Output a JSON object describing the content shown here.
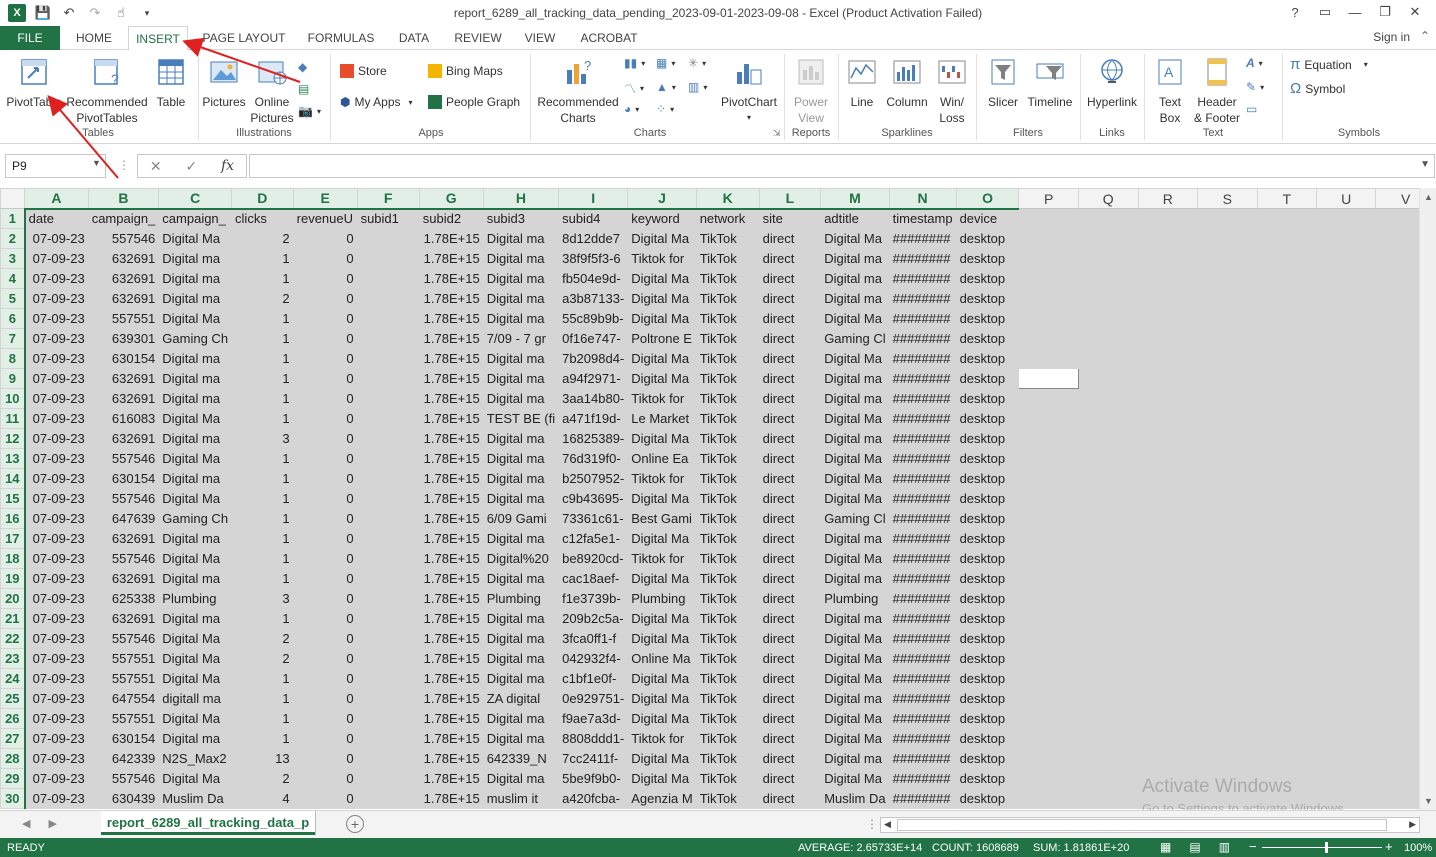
{
  "window": {
    "title": "report_6289_all_tracking_data_pending_2023-09-01-2023-09-08 - Excel (Product Activation Failed)",
    "controls": [
      "?",
      "▭",
      "—",
      "❐",
      "✕"
    ]
  },
  "tabs": [
    "FILE",
    "HOME",
    "INSERT",
    "PAGE LAYOUT",
    "FORMULAS",
    "DATA",
    "REVIEW",
    "VIEW",
    "ACROBAT"
  ],
  "signin": "Sign in",
  "ribbon": {
    "tables": {
      "pivottable": "PivotTable",
      "recommended_line1": "Recommended",
      "recommended_line2": "PivotTables",
      "table": "Table",
      "group": "Tables"
    },
    "illustrations": {
      "pictures": "Pictures",
      "online_line1": "Online",
      "online_line2": "Pictures",
      "group": "Illustrations"
    },
    "apps": {
      "store": "Store",
      "my_apps": "My Apps",
      "bing_maps": "Bing Maps",
      "people_graph": "People Graph",
      "group": "Apps"
    },
    "charts": {
      "recommended_line1": "Recommended",
      "recommended_line2": "Charts",
      "pivotchart": "PivotChart",
      "group": "Charts"
    },
    "reports": {
      "power_line1": "Power",
      "power_line2": "View",
      "group": "Reports"
    },
    "sparklines": {
      "line": "Line",
      "column": "Column",
      "winloss_line1": "Win/",
      "winloss_line2": "Loss",
      "group": "Sparklines"
    },
    "filters": {
      "slicer": "Slicer",
      "timeline": "Timeline",
      "group": "Filters"
    },
    "links": {
      "hyperlink": "Hyperlink",
      "group": "Links"
    },
    "text": {
      "textbox_line1": "Text",
      "textbox_line2": "Box",
      "header_line1": "Header",
      "header_line2": "& Footer",
      "group": "Text"
    },
    "symbols": {
      "equation": "Equation",
      "symbol": "Symbol",
      "group": "Symbols"
    }
  },
  "formula_bar": {
    "name_box": "P9",
    "fx": "fx",
    "value": ""
  },
  "columns": [
    "A",
    "B",
    "C",
    "D",
    "E",
    "F",
    "G",
    "H",
    "I",
    "J",
    "K",
    "L",
    "M",
    "N",
    "O",
    "P",
    "Q",
    "R",
    "S",
    "T",
    "U",
    "V"
  ],
  "header_row": [
    "date",
    "campaign_",
    "campaign_",
    "clicks",
    "revenueU",
    "subid1",
    "subid2",
    "subid3",
    "subid4",
    "keyword",
    "network",
    "site",
    "adtitle",
    "timestamp",
    "device"
  ],
  "rows": [
    [
      "07-09-23",
      "557546",
      "Digital Ma",
      "2",
      "0",
      "",
      "1.78E+15",
      "Digital ma",
      "8d12dde7",
      "Digital Ma",
      "TikTok",
      "direct",
      "Digital Ma",
      "########",
      "desktop"
    ],
    [
      "07-09-23",
      "632691",
      "Digital ma",
      "1",
      "0",
      "",
      "1.78E+15",
      "Digital ma",
      "38f9f5f3-6",
      "Tiktok for",
      "TikTok",
      "direct",
      "Digital ma",
      "########",
      "desktop"
    ],
    [
      "07-09-23",
      "632691",
      "Digital ma",
      "1",
      "0",
      "",
      "1.78E+15",
      "Digital ma",
      "fb504e9d-",
      "Digital Ma",
      "TikTok",
      "direct",
      "Digital ma",
      "########",
      "desktop"
    ],
    [
      "07-09-23",
      "632691",
      "Digital ma",
      "2",
      "0",
      "",
      "1.78E+15",
      "Digital ma",
      "a3b87133-",
      "Digital Ma",
      "TikTok",
      "direct",
      "Digital ma",
      "########",
      "desktop"
    ],
    [
      "07-09-23",
      "557551",
      "Digital Ma",
      "1",
      "0",
      "",
      "1.78E+15",
      "Digital ma",
      "55c89b9b-",
      "Digital Ma",
      "TikTok",
      "direct",
      "Digital Ma",
      "########",
      "desktop"
    ],
    [
      "07-09-23",
      "639301",
      "Gaming Ch",
      "1",
      "0",
      "",
      "1.78E+15",
      "7/09 - 7 gr",
      "0f16e747-",
      "Poltrone E",
      "TikTok",
      "direct",
      "Gaming Cl",
      "########",
      "desktop"
    ],
    [
      "07-09-23",
      "630154",
      "Digital ma",
      "1",
      "0",
      "",
      "1.78E+15",
      "Digital ma",
      "7b2098d4-",
      "Digital Ma",
      "TikTok",
      "direct",
      " Digital Ma",
      "########",
      "desktop"
    ],
    [
      "07-09-23",
      "632691",
      "Digital ma",
      "1",
      "0",
      "",
      "1.78E+15",
      "Digital ma",
      "a94f2971-",
      "Digital Ma",
      "TikTok",
      "direct",
      "Digital ma",
      "########",
      "desktop"
    ],
    [
      "07-09-23",
      "632691",
      "Digital ma",
      "1",
      "0",
      "",
      "1.78E+15",
      "Digital ma",
      "3aa14b80-",
      "Tiktok for",
      "TikTok",
      "direct",
      "Digital ma",
      "########",
      "desktop"
    ],
    [
      "07-09-23",
      "616083",
      "Digital Ma",
      "1",
      "0",
      "",
      "1.78E+15",
      "TEST BE (fi",
      "a471f19d-",
      "Le Market",
      "TikTok",
      "direct",
      "Digital Ma",
      "########",
      "desktop"
    ],
    [
      "07-09-23",
      "632691",
      "Digital ma",
      "3",
      "0",
      "",
      "1.78E+15",
      "Digital ma",
      "16825389-",
      "Digital Ma",
      "TikTok",
      "direct",
      "Digital ma",
      "########",
      "desktop"
    ],
    [
      "07-09-23",
      "557546",
      "Digital Ma",
      "1",
      "0",
      "",
      "1.78E+15",
      "Digital ma",
      "76d319f0-",
      "Online Ea",
      "TikTok",
      "direct",
      "Digital Ma",
      "########",
      "desktop"
    ],
    [
      "07-09-23",
      "630154",
      "Digital ma",
      "1",
      "0",
      "",
      "1.78E+15",
      "Digital ma",
      "b2507952-",
      "Tiktok for",
      "TikTok",
      "direct",
      " Digital Ma",
      "########",
      "desktop"
    ],
    [
      "07-09-23",
      "557546",
      "Digital Ma",
      "1",
      "0",
      "",
      "1.78E+15",
      "Digital ma",
      "c9b43695-",
      "Digital Ma",
      "TikTok",
      "direct",
      "Digital Ma",
      "########",
      "desktop"
    ],
    [
      "07-09-23",
      "647639",
      "Gaming Ch",
      "1",
      "0",
      "",
      "1.78E+15",
      "6/09 Gami",
      "73361c61-",
      "Best Gami",
      "TikTok",
      "direct",
      "Gaming Cl",
      "########",
      "desktop"
    ],
    [
      "07-09-23",
      "632691",
      "Digital ma",
      "1",
      "0",
      "",
      "1.78E+15",
      "Digital ma",
      "c12fa5e1-",
      "Digital Ma",
      "TikTok",
      "direct",
      "Digital ma",
      "########",
      "desktop"
    ],
    [
      "07-09-23",
      "557546",
      "Digital Ma",
      "1",
      "0",
      "",
      "1.78E+15",
      "Digital%20",
      "be8920cd-",
      "Tiktok for",
      "TikTok",
      "direct",
      "Digital Ma",
      "########",
      "desktop"
    ],
    [
      "07-09-23",
      "632691",
      "Digital ma",
      "1",
      "0",
      "",
      "1.78E+15",
      "Digital ma",
      "cac18aef-",
      "Digital Ma",
      "TikTok",
      "direct",
      "Digital ma",
      "########",
      "desktop"
    ],
    [
      "07-09-23",
      "625338",
      "Plumbing",
      "3",
      "0",
      "",
      "1.78E+15",
      " Plumbing",
      "f1e3739b-",
      "Plumbing",
      "TikTok",
      "direct",
      "Plumbing",
      "########",
      "desktop"
    ],
    [
      "07-09-23",
      "632691",
      "Digital ma",
      "1",
      "0",
      "",
      "1.78E+15",
      "Digital ma",
      "209b2c5a-",
      "Digital Ma",
      "TikTok",
      "direct",
      "Digital ma",
      "########",
      "desktop"
    ],
    [
      "07-09-23",
      "557546",
      "Digital Ma",
      "2",
      "0",
      "",
      "1.78E+15",
      "Digital ma",
      "3fca0ff1-f",
      "Digital Ma",
      "TikTok",
      "direct",
      "Digital Ma",
      "########",
      "desktop"
    ],
    [
      "07-09-23",
      "557551",
      "Digital Ma",
      "2",
      "0",
      "",
      "1.78E+15",
      "Digital ma",
      "042932f4-",
      "Online Ma",
      "TikTok",
      "direct",
      "Digital Ma",
      "########",
      "desktop"
    ],
    [
      "07-09-23",
      "557551",
      "Digital Ma",
      "1",
      "0",
      "",
      "1.78E+15",
      "Digital ma",
      "c1bf1e0f-",
      "Digital Ma",
      "TikTok",
      "direct",
      "Digital Ma",
      "########",
      "desktop"
    ],
    [
      "07-09-23",
      "647554",
      "digitall ma",
      "1",
      "0",
      "",
      "1.78E+15",
      "ZA digital",
      "0e929751-",
      "Digital Ma",
      "TikTok",
      "direct",
      "Digital ma",
      "########",
      "desktop"
    ],
    [
      "07-09-23",
      "557551",
      "Digital Ma",
      "1",
      "0",
      "",
      "1.78E+15",
      "Digital ma",
      "f9ae7a3d-",
      "Digital Ma",
      "TikTok",
      "direct",
      "Digital Ma",
      "########",
      "desktop"
    ],
    [
      "07-09-23",
      "630154",
      "Digital ma",
      "1",
      "0",
      "",
      "1.78E+15",
      "Digital ma",
      "8808ddd1-",
      "Tiktok for",
      "TikTok",
      "direct",
      " Digital Ma",
      "########",
      "desktop"
    ],
    [
      "07-09-23",
      "642339",
      "N2S_Max2",
      "13",
      "0",
      "",
      "1.78E+15",
      "642339_N",
      "7cc2411f-",
      "Digital Ma",
      "TikTok",
      "direct",
      "Digital ma",
      "########",
      "desktop"
    ],
    [
      "07-09-23",
      "557546",
      "Digital Ma",
      "2",
      "0",
      "",
      "1.78E+15",
      "Digital ma",
      "5be9f9b0-",
      "Digital Ma",
      "TikTok",
      "direct",
      "Digital Ma",
      "########",
      "desktop"
    ],
    [
      "07-09-23",
      "630439",
      "Muslim Da",
      "4",
      "0",
      "",
      "1.78E+15",
      "muslim it",
      "a420fcba-",
      "Agenzia M",
      "TikTok",
      "direct",
      "Muslim Da",
      "########",
      "desktop"
    ]
  ],
  "sheet_tab": "report_6289_all_tracking_data_p",
  "status": {
    "ready": "READY",
    "average": "AVERAGE: 2.65733E+14",
    "count": "COUNT: 1608689",
    "sum": "SUM: 1.81861E+20",
    "zoom": "100%"
  },
  "watermark": {
    "line1": "Activate Windows",
    "line2": "Go to Settings to activate Windows."
  },
  "colors": {
    "excel_green": "#217346",
    "cell_gray": "#d5d5d5",
    "arrow_red": "#e02020"
  }
}
